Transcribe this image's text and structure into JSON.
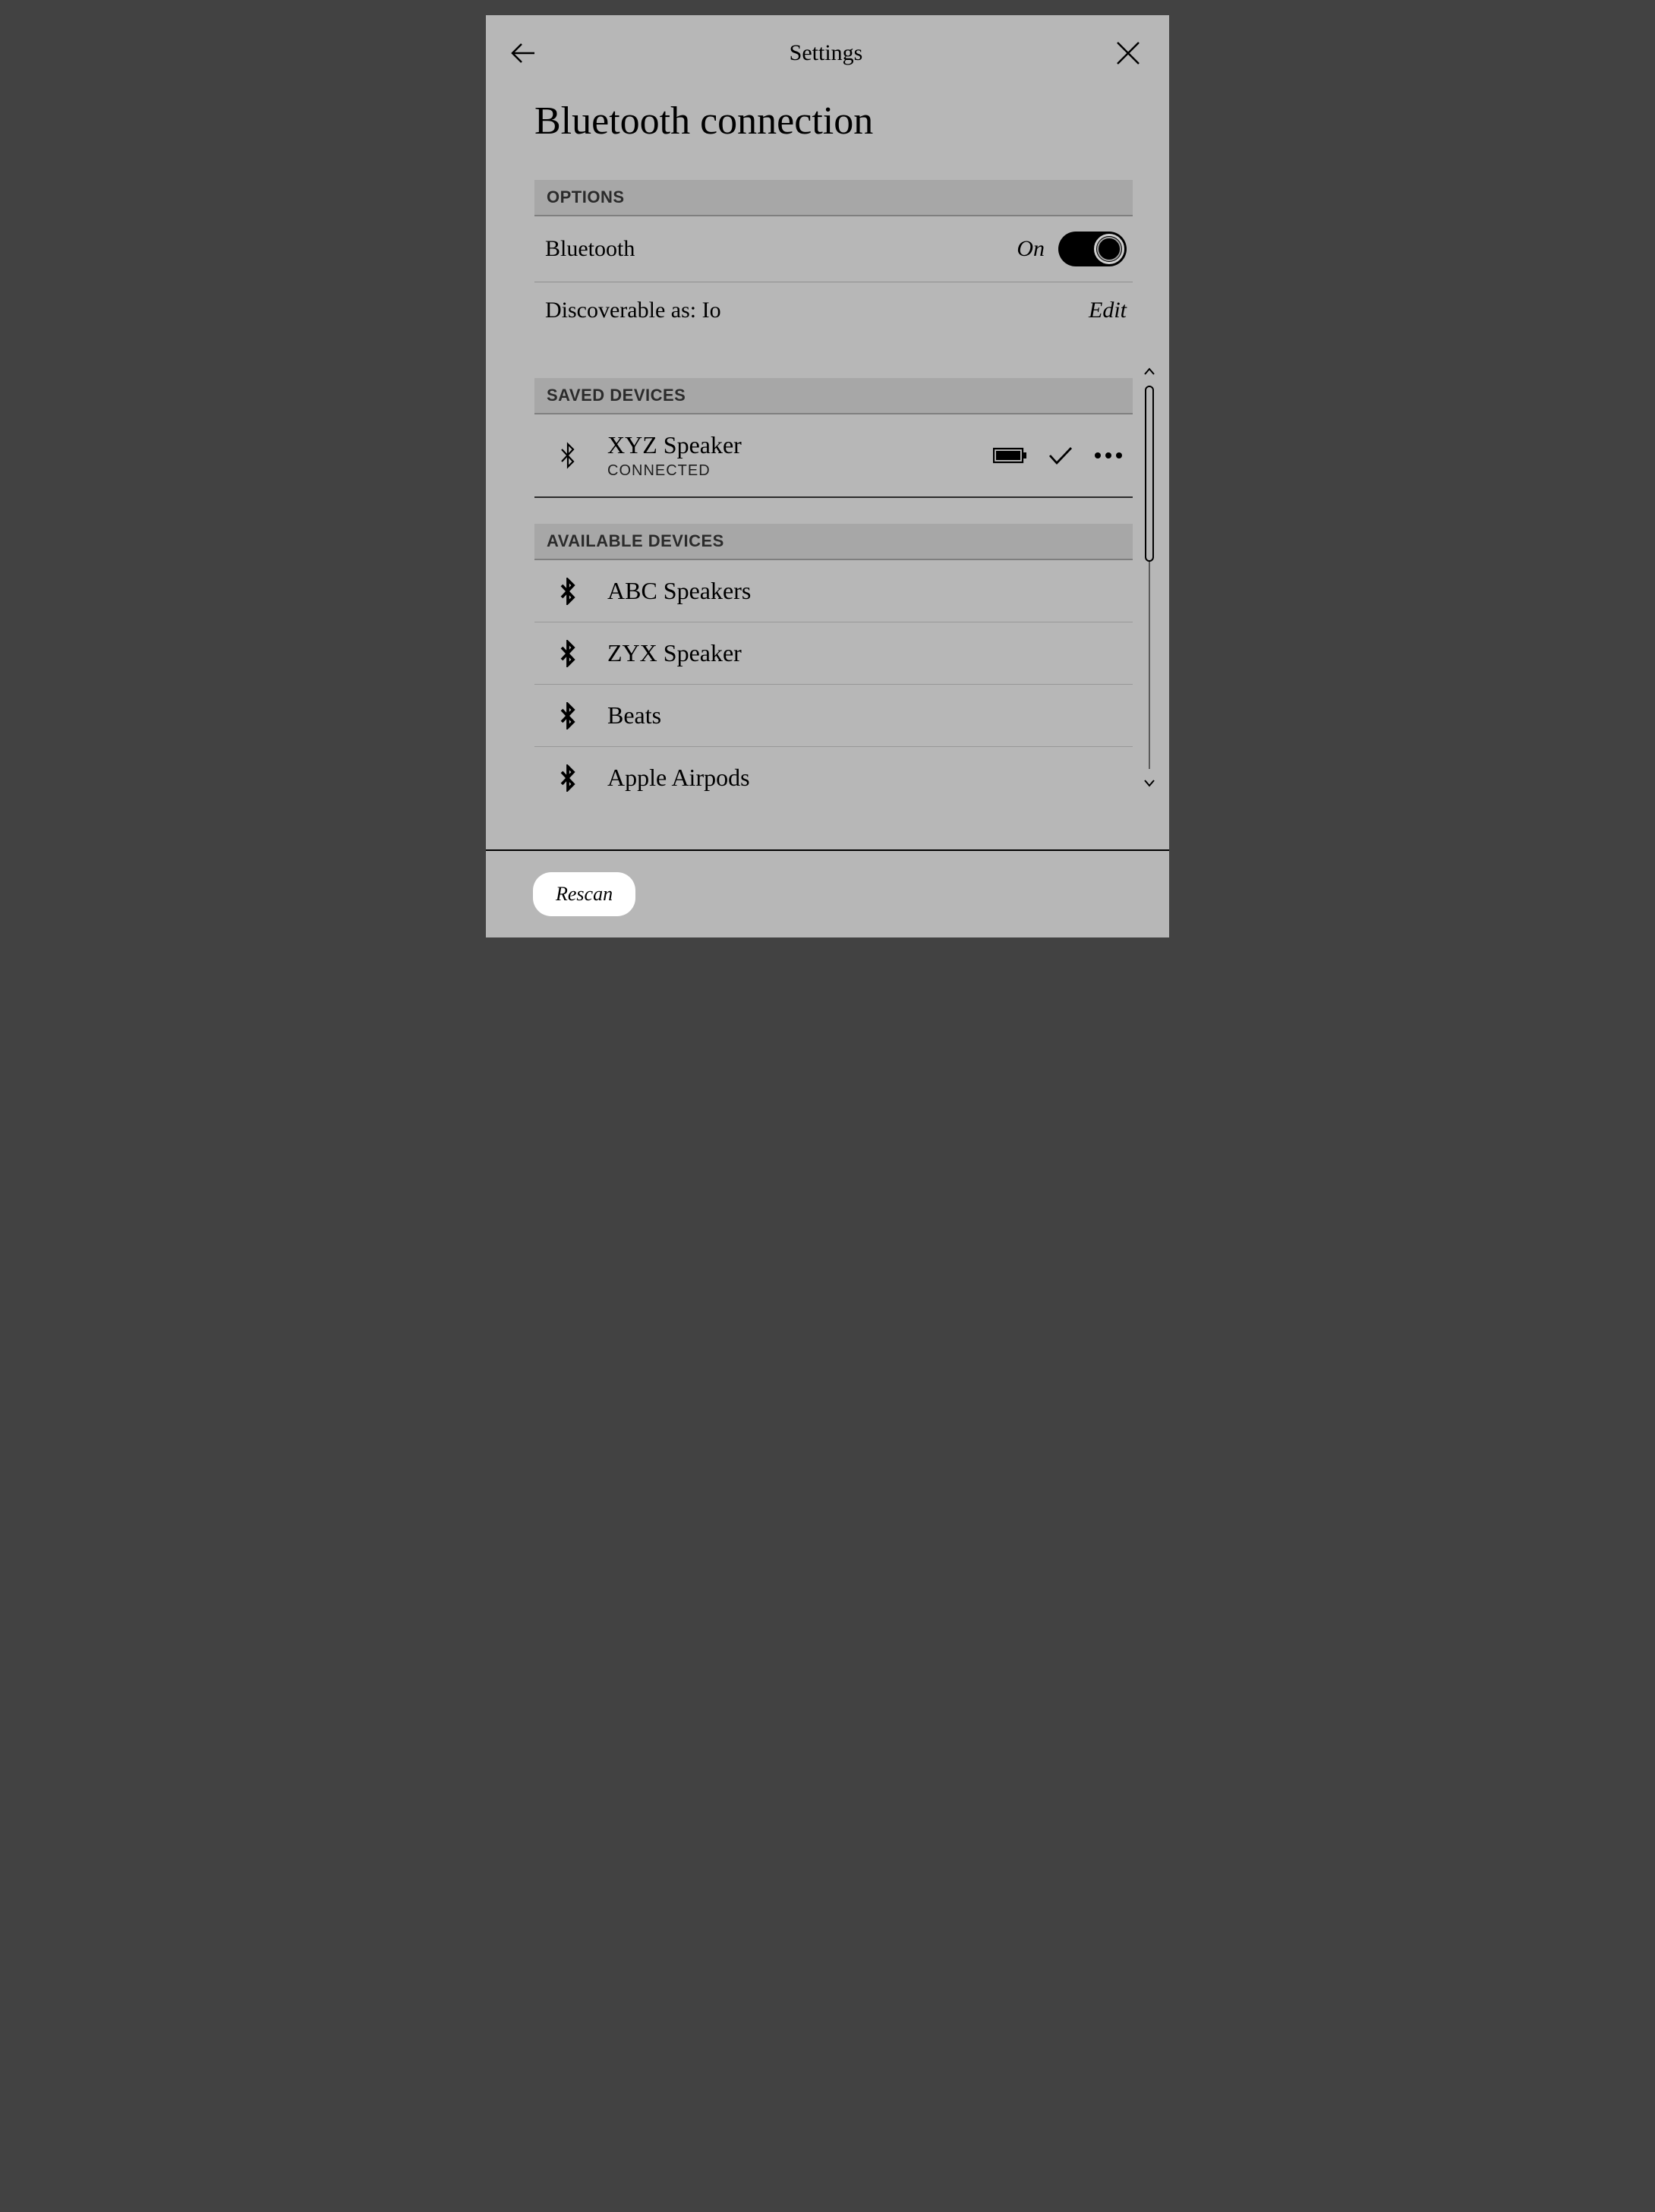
{
  "header": {
    "title": "Settings"
  },
  "page": {
    "title": "Bluetooth connection"
  },
  "sections": {
    "options": "OPTIONS",
    "saved": "SAVED DEVICES",
    "available": "AVAILABLE DEVICES"
  },
  "options": {
    "bluetooth_label": "Bluetooth",
    "bluetooth_state": "On",
    "discoverable_label": "Discoverable as: Io",
    "edit_label": "Edit"
  },
  "saved_devices": [
    {
      "name": "XYZ Speaker",
      "status": "CONNECTED"
    }
  ],
  "available_devices": [
    {
      "name": "ABC Speakers"
    },
    {
      "name": "ZYX Speaker"
    },
    {
      "name": "Beats"
    },
    {
      "name": "Apple Airpods"
    }
  ],
  "footer": {
    "rescan": "Rescan"
  }
}
